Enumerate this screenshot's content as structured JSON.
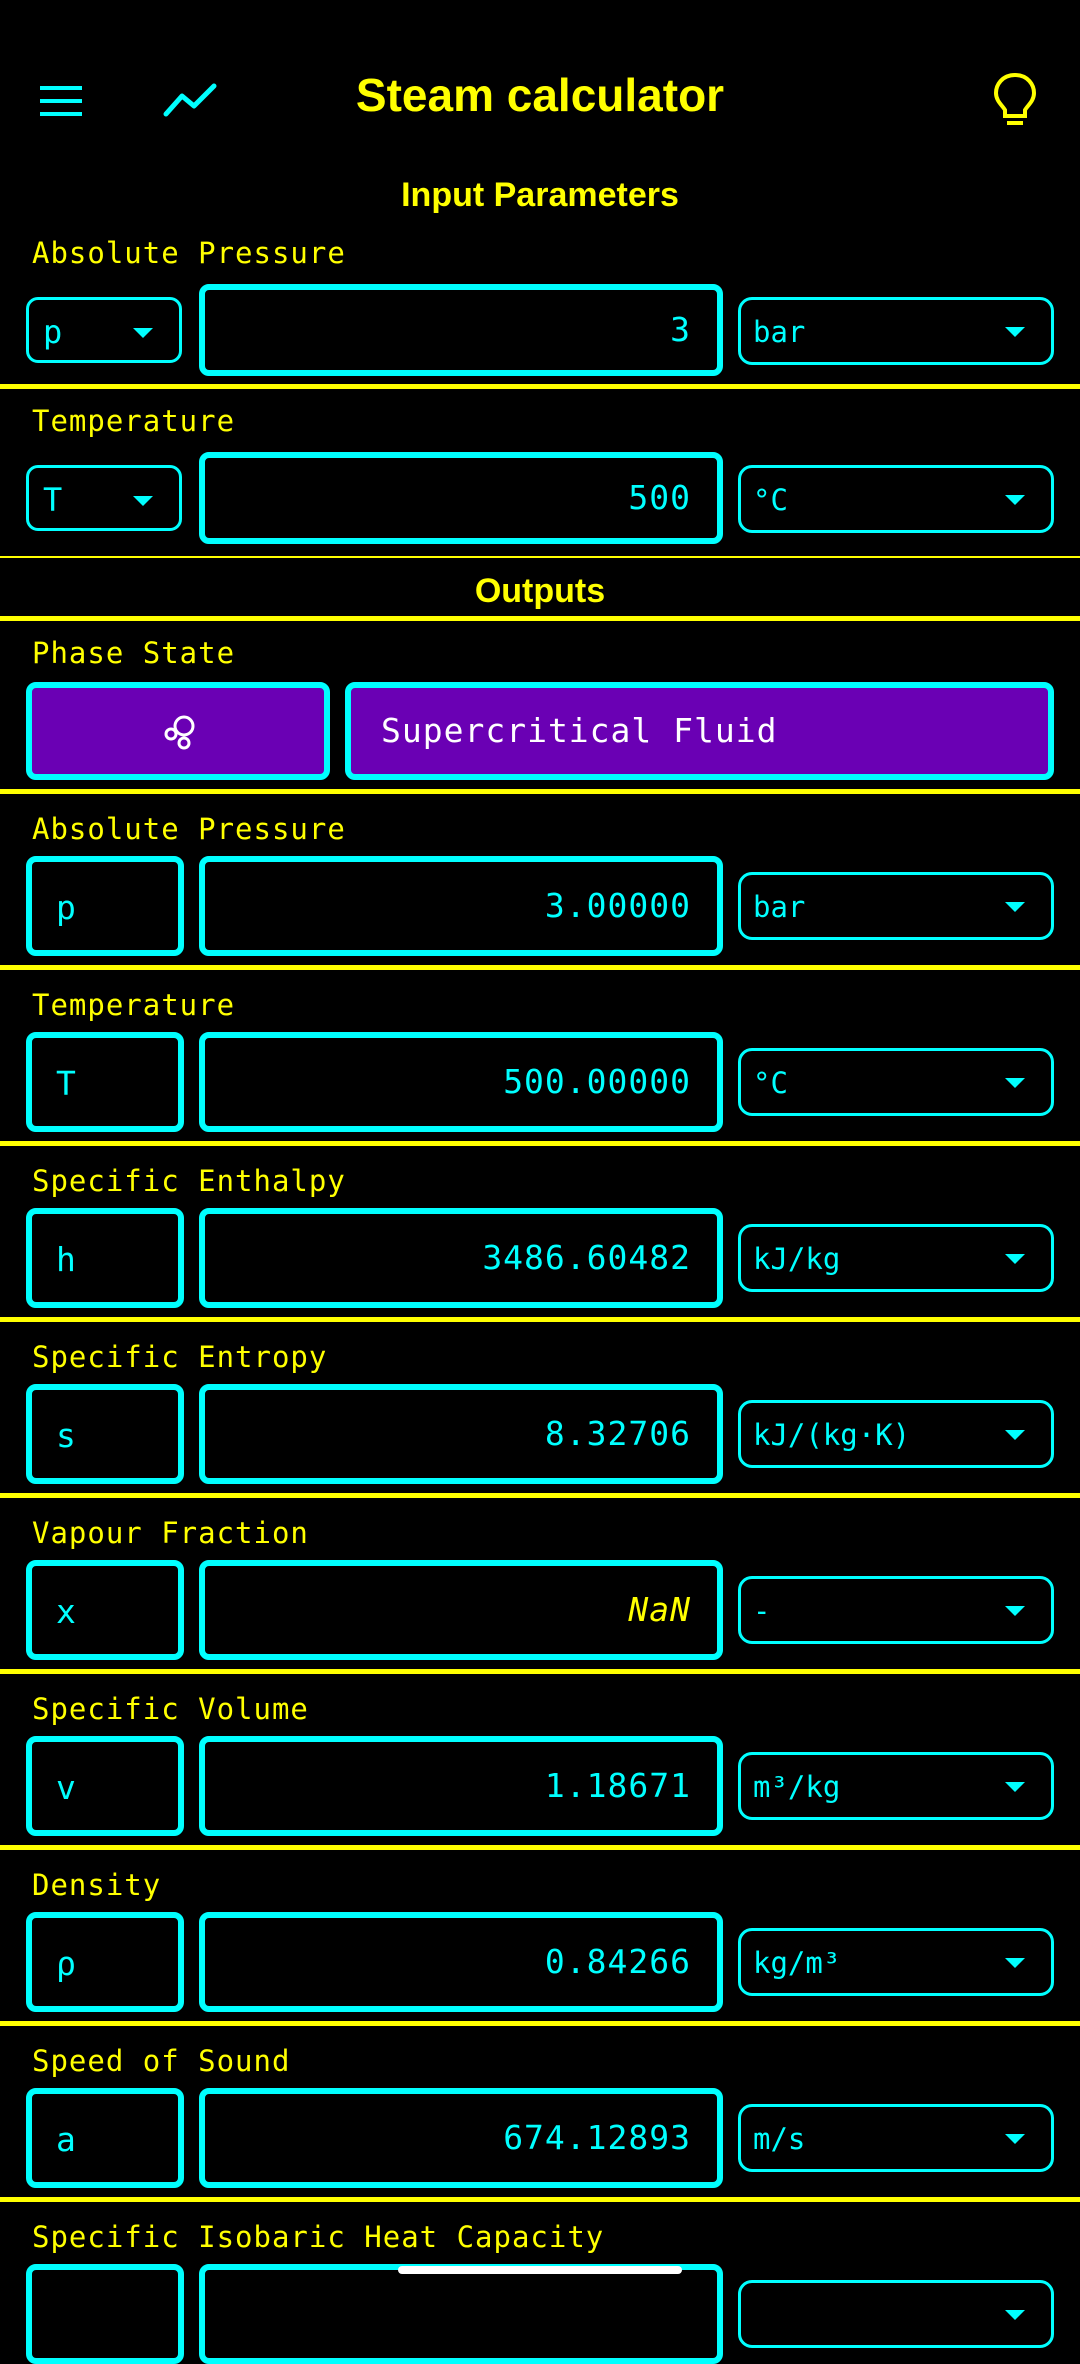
{
  "appbar": {
    "title": "Steam calculator",
    "icons": [
      "menu-icon",
      "trend-chart-icon",
      "lightbulb-icon"
    ]
  },
  "inputs": {
    "heading": "Input Parameters",
    "pressure": {
      "label": "Absolute Pressure",
      "symbol": "p",
      "value": "3",
      "unit": "bar"
    },
    "temperature": {
      "label": "Temperature",
      "symbol": "T",
      "value": "500",
      "unit": "°C"
    }
  },
  "outputs": {
    "heading": "Outputs",
    "phase": {
      "label": "Phase State",
      "value": "Supercritical Fluid",
      "icon": "bubbles-icon"
    },
    "rows": [
      {
        "label": "Absolute Pressure",
        "symbol": "p",
        "value": "3.00000",
        "unit": "bar"
      },
      {
        "label": "Temperature",
        "symbol": "T",
        "value": "500.00000",
        "unit": "°C"
      },
      {
        "label": "Specific Enthalpy",
        "symbol": "h",
        "value": "3486.60482",
        "unit": "kJ/kg"
      },
      {
        "label": "Specific Entropy",
        "symbol": "s",
        "value": "8.32706",
        "unit": "kJ/(kg·K)"
      },
      {
        "label": "Vapour Fraction",
        "symbol": "x",
        "value": "NaN",
        "unit": "-"
      },
      {
        "label": "Specific Volume",
        "symbol": "v",
        "value": "1.18671",
        "unit": "m³/kg"
      },
      {
        "label": "Density",
        "symbol": "ρ",
        "value": "0.84266",
        "unit": "kg/m³"
      },
      {
        "label": "Speed of Sound",
        "symbol": "a",
        "value": "674.12893",
        "unit": "m/s"
      },
      {
        "label": "Specific Isobaric Heat Capacity",
        "symbol": "",
        "value": "",
        "unit": ""
      }
    ]
  },
  "colors": {
    "background": "#000000",
    "accent_yellow": "#ffff00",
    "accent_cyan": "#00ffff",
    "phase_purple": "#6a00b4"
  }
}
